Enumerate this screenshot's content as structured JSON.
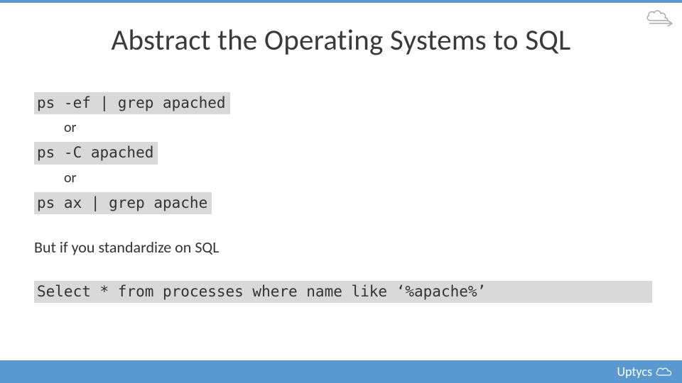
{
  "title": "Abstract the Operating Systems to SQL",
  "commands": {
    "cmd1": "ps -ef | grep apached",
    "or": "or",
    "cmd2": "ps -C apached",
    "cmd3": "ps ax | grep apache"
  },
  "subhead": "But if you standardize on SQL",
  "sql": "Select * from processes where name like ‘%apache%’",
  "brand": "Uptycs",
  "colors": {
    "accent": "#5a98d0",
    "code_bg": "#d9d9d9"
  }
}
